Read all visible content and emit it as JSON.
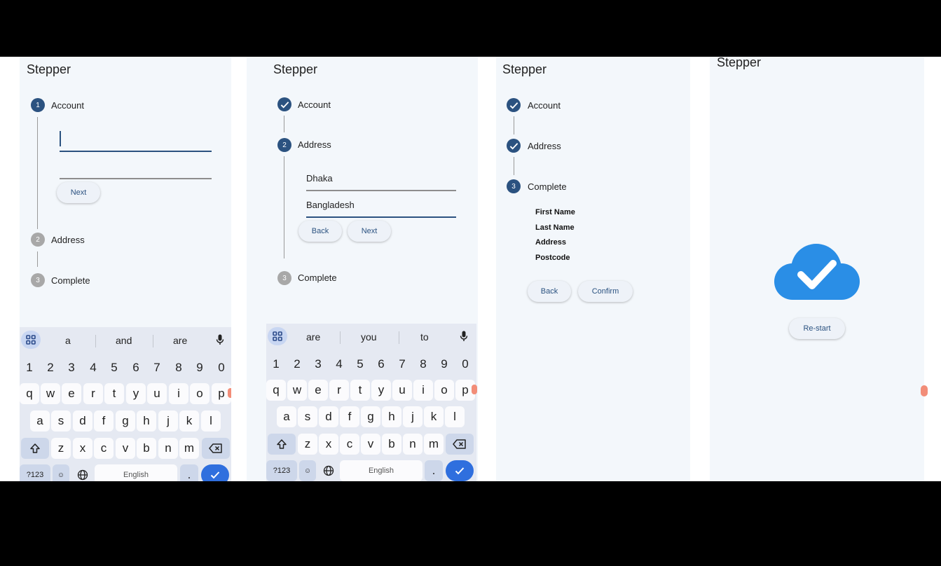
{
  "app_title": "Stepper",
  "steps": [
    "Account",
    "Address",
    "Complete"
  ],
  "step_numbers": [
    "1",
    "2",
    "3"
  ],
  "screen1": {
    "next_label": "Next"
  },
  "screen2": {
    "city_value": "Dhaka",
    "country_value": "Bangladesh",
    "back_label": "Back",
    "next_label": "Next"
  },
  "screen3": {
    "summary_fields": [
      "First Name",
      "Last Name",
      "Address",
      "Postcode"
    ],
    "back_label": "Back",
    "confirm_label": "Confirm"
  },
  "screen4": {
    "restart_label": "Re-start",
    "icon": "cloud-check-icon"
  },
  "keyboard1": {
    "suggestions": [
      "a",
      "and",
      "are"
    ]
  },
  "keyboard2": {
    "suggestions": [
      "are",
      "you",
      "to"
    ]
  },
  "keyboard": {
    "numbers": [
      "1",
      "2",
      "3",
      "4",
      "5",
      "6",
      "7",
      "8",
      "9",
      "0"
    ],
    "row1": [
      "q",
      "w",
      "e",
      "r",
      "t",
      "y",
      "u",
      "i",
      "o",
      "p"
    ],
    "row2": [
      "a",
      "s",
      "d",
      "f",
      "g",
      "h",
      "j",
      "k",
      "l"
    ],
    "row3": [
      "z",
      "x",
      "c",
      "v",
      "b",
      "n",
      "m"
    ],
    "symbols_label": "?123",
    "emoji_label": "☺",
    "comma_label": ",",
    "space_label": "English",
    "period_label": "."
  },
  "colors": {
    "primary": "#2b5280",
    "inactive": "#a8a8a8",
    "background": "#f3f7fb",
    "cloud": "#2a8ee6",
    "enter_key": "#2f6fde"
  }
}
